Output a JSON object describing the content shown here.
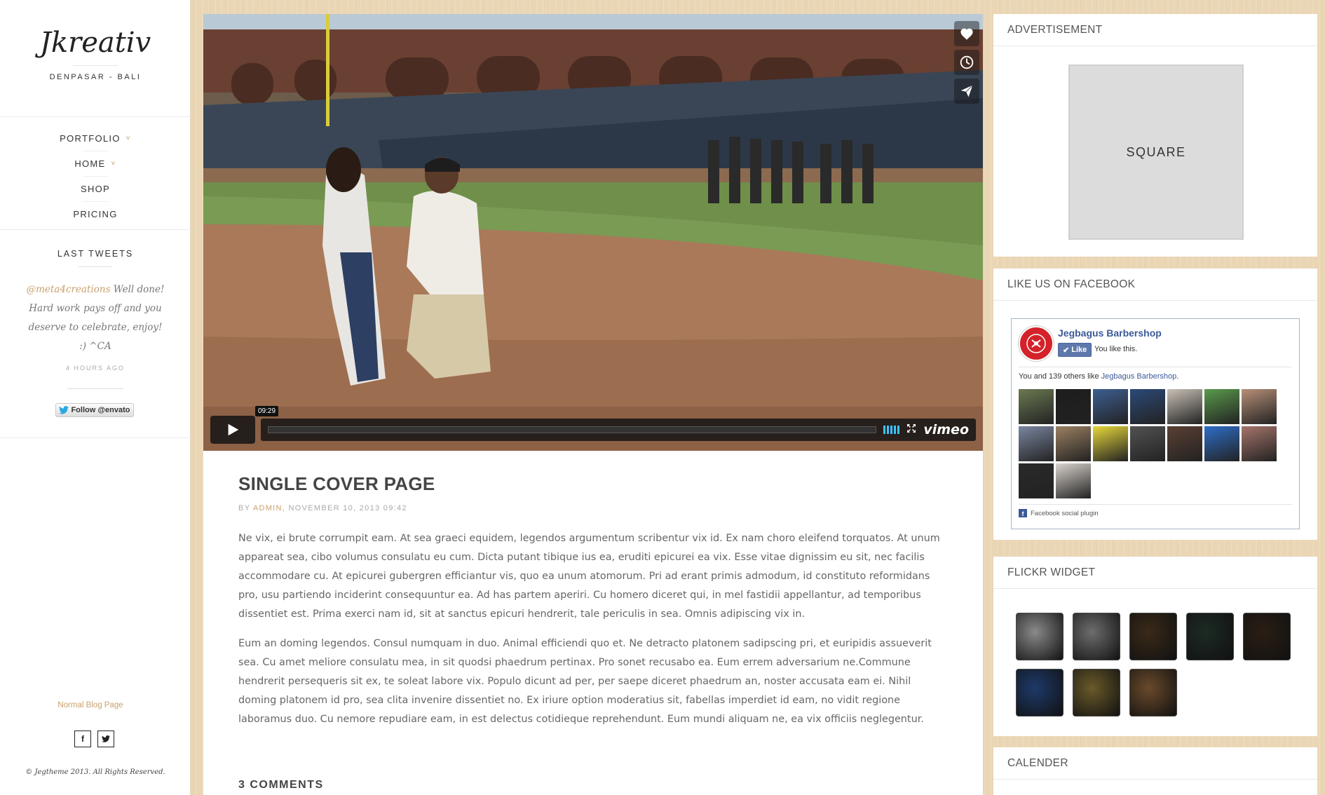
{
  "site": {
    "logo": "Jkreativ",
    "tagline": "DENPASAR - BALI",
    "nav": [
      {
        "label": "PORTFOLIO",
        "has_dropdown": true
      },
      {
        "label": "HOME",
        "has_dropdown": true
      },
      {
        "label": "SHOP",
        "has_dropdown": false
      },
      {
        "label": "PRICING",
        "has_dropdown": false
      }
    ],
    "chevron": "˅",
    "tweets": {
      "title": "LAST TWEETS",
      "handle": "@meta4creations",
      "text": " Well done! Hard work pays off and you deserve to celebrate, enjoy! :) ^CA",
      "time": "4 HOURS AGO",
      "follow_label": "Follow @envato"
    },
    "blog_link": "Normal Blog Page",
    "social": {
      "facebook": "f",
      "twitter": "twitter-icon"
    },
    "copyright": "© Jegtheme 2013. All Rights Reserved."
  },
  "video": {
    "time": "09:29",
    "provider": "vimeo",
    "icons": [
      "heart-icon",
      "clock-icon",
      "send-icon"
    ]
  },
  "post": {
    "title": "SINGLE COVER PAGE",
    "meta_by": "BY ",
    "meta_author": "ADMIN",
    "meta_date": ", NOVEMBER 10, 2013 09:42",
    "paragraphs": [
      "Ne vix, ei brute corrumpit eam. At sea graeci equidem, legendos argumentum scribentur vix id. Ex nam choro eleifend torquatos. At unum appareat sea, cibo volumus consulatu eu cum. Dicta putant tibique ius ea, eruditi epicurei ea vix. Esse vitae dignissim eu sit, nec facilis accommodare cu. At epicurei gubergren efficiantur vis, quo ea unum atomorum. Pri ad erant primis admodum, id constituto reformidans pro, usu partiendo inciderint consequuntur ea. Ad has partem aperiri. Cu homero diceret qui, in mel fastidii appellantur, ad temporibus dissentiet est. Prima exerci nam id, sit at sanctus epicuri hendrerit, tale periculis in sea. Omnis adipiscing vix in.",
      "Eum an doming legendos. Consul numquam in duo. Animal efficiendi quo et. Ne detracto platonem sadipscing pri, et euripidis assueverit sea. Cu amet meliore consulatu mea, in sit quodsi phaedrum pertinax. Pro sonet recusabo ea. Eum errem adversarium ne.Commune hendrerit persequeris sit ex, te soleat labore vix. Populo dicunt ad per, per saepe diceret phaedrum an, noster accusata eam ei. Nihil doming platonem id pro, sea clita invenire dissentiet no. Ex iriure option moderatius sit, fabellas imperdiet id eam, no vidit regione laboramus duo. Cu nemore repudiare eam, in est delectus cotidieque reprehendunt. Eum mundi aliquam ne, ea vix officiis neglegentur."
    ],
    "comments_title": "3 COMMENTS"
  },
  "widgets": {
    "advertisement": {
      "title": "ADVERTISEMENT",
      "box_label": "SQUARE"
    },
    "facebook": {
      "title": "LIKE US ON FACEBOOK",
      "page_name": "Jegbagus Barbershop",
      "like_label": "Like",
      "you_like": "You like this.",
      "count_prefix": "You and 139 others like ",
      "count_link": "Jegbagus Barbershop",
      "count_suffix": ".",
      "plugin_label": "Facebook social plugin",
      "faces": [
        "#6a7a52",
        "#1d1d1d",
        "#3d5f92",
        "#2c4a78",
        "#c9c1b7",
        "#5a9a4c",
        "#b78f78",
        "#7a86a0",
        "#9b8062",
        "#e7d83a",
        "#525252",
        "#5b4033",
        "#2e6ec8",
        "#a5756a",
        "#2a2a2a",
        "#d9d3cc"
      ]
    },
    "flickr": {
      "title": "FLICKR WIDGET",
      "photos": [
        "#8a8a8a",
        "#6d6d6d",
        "#3a2a18",
        "#1d2a24",
        "#2a1e14",
        "#1e3a6a",
        "#6a5a2a",
        "#6a4a2a"
      ]
    },
    "calendar": {
      "title": "CALENDER"
    }
  }
}
